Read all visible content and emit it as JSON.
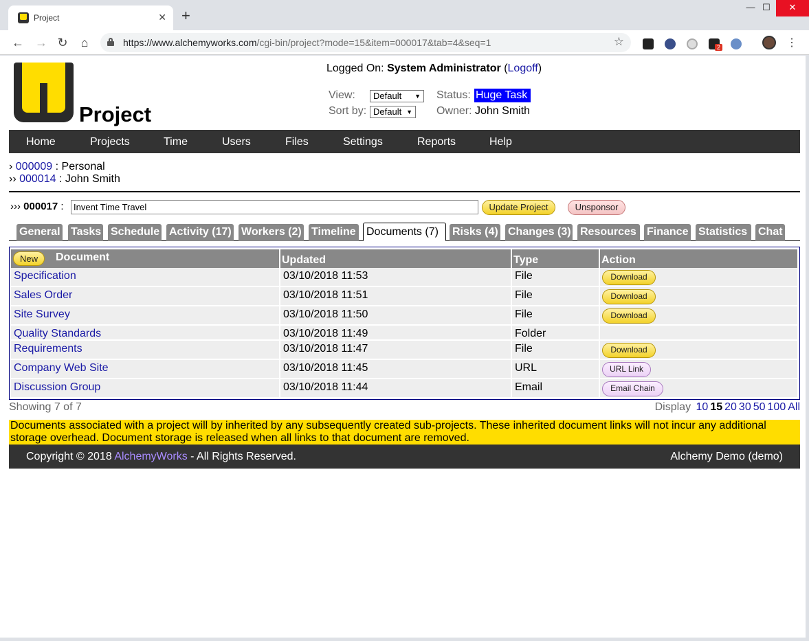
{
  "browser": {
    "tab_title": "Project",
    "new_tab": "+",
    "url_domain": "https://www.alchemyworks.com",
    "url_path": "/cgi-bin/project?mode=15&item=000017&tab=4&seq=1",
    "extension_badge": "2"
  },
  "header": {
    "brand": "Project",
    "logged_on_label": "Logged On:",
    "user": "System Administrator",
    "logoff": "Logoff",
    "view_label": "View:",
    "view_value": "Default",
    "sort_label": "Sort by:",
    "sort_value": "Default",
    "status_label": "Status:",
    "status_value": "Huge Task",
    "owner_label": "Owner:",
    "owner_value": "John Smith"
  },
  "nav": [
    "Home",
    "Projects",
    "Time",
    "Users",
    "Files",
    "Settings",
    "Reports",
    "Help"
  ],
  "breadcrumbs": [
    {
      "prefix": "›",
      "id": "000009",
      "name": "Personal"
    },
    {
      "prefix": "››",
      "id": "000014",
      "name": "John Smith"
    }
  ],
  "project": {
    "prefix": "›››",
    "id": "000017",
    "title": "Invent Time Travel",
    "update_label": "Update Project",
    "unsponsor_label": "Unsponsor"
  },
  "tabs": [
    "General",
    "Tasks",
    "Schedule",
    "Activity (17)",
    "Workers (2)",
    "Timeline",
    "Documents (7)",
    "Risks (4)",
    "Changes (3)",
    "Resources",
    "Finance",
    "Statistics",
    "Chat"
  ],
  "table": {
    "new_label": "New",
    "headers": [
      "Document",
      "Updated",
      "Type",
      "Action"
    ],
    "rows": [
      {
        "name": "Specification",
        "updated": "03/10/2018 11:53",
        "type": "File",
        "action": "Download"
      },
      {
        "name": "Sales Order",
        "updated": "03/10/2018 11:51",
        "type": "File",
        "action": "Download"
      },
      {
        "name": "Site Survey",
        "updated": "03/10/2018 11:50",
        "type": "File",
        "action": "Download"
      },
      {
        "name": "Quality Standards",
        "updated": "03/10/2018 11:49",
        "type": "Folder",
        "action": ""
      },
      {
        "name": "Requirements",
        "updated": "03/10/2018 11:47",
        "type": "File",
        "action": "Download"
      },
      {
        "name": "Company Web Site",
        "updated": "03/10/2018 11:45",
        "type": "URL",
        "action": "URL Link"
      },
      {
        "name": "Discussion Group",
        "updated": "03/10/2018 11:44",
        "type": "Email",
        "action": "Email Chain"
      }
    ]
  },
  "pager": {
    "showing": "Showing 7 of 7",
    "display_label": "Display",
    "options": [
      "10",
      "15",
      "20",
      "30",
      "50",
      "100",
      "All"
    ],
    "current": "15"
  },
  "note": "Documents associated with a project will by inherited by any subsequently created sub-projects. These inherited document links will not incur any additional storage overhead. Document storage is released when all links to that document are removed.",
  "footer": {
    "copyright": "Copyright © 2018",
    "company": "AlchemyWorks",
    "rights": "- All Rights Reserved.",
    "instance": "Alchemy Demo (demo)"
  }
}
